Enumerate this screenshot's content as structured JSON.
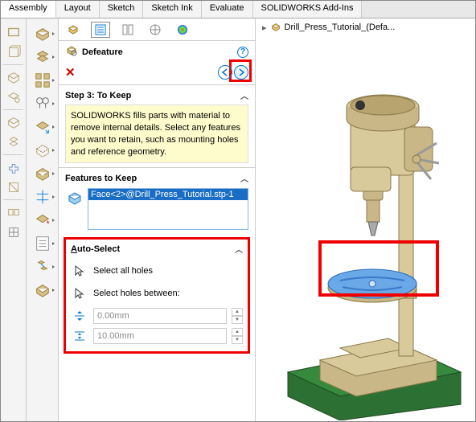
{
  "tabs": [
    "Assembly",
    "Layout",
    "Sketch",
    "Sketch Ink",
    "Evaluate",
    "SOLIDWORKS Add-Ins"
  ],
  "active_tab": 0,
  "panel": {
    "title": "Defeature",
    "step_title": "Step 3: To Keep",
    "step_text": "SOLIDWORKS fills parts with material to remove internal details. Select any features you want to retain, such as mounting holes and reference geometry.",
    "features_title": "Features to Keep",
    "features_item": "Face<2>@Drill_Press_Tutorial.stp-1",
    "auto_title": "Auto-Select",
    "auto_all": "Select all holes",
    "auto_between": "Select holes between:",
    "dim_min": "0.00mm",
    "dim_max": "10.00mm",
    "help": "?"
  },
  "breadcrumb": {
    "label": "Drill_Press_Tutorial_(Defa..."
  }
}
